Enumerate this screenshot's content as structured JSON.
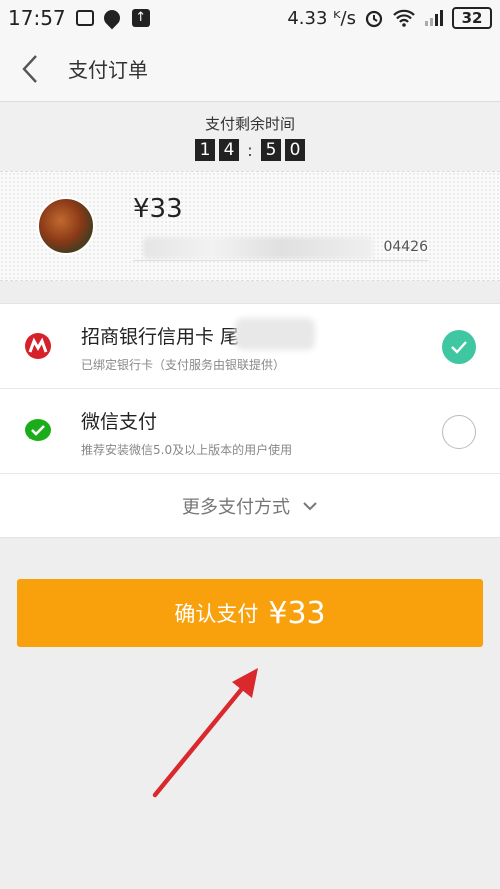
{
  "status_bar": {
    "time": "17:57",
    "speed": "4.33 ᴷ/s",
    "battery": "32",
    "icons": [
      "image-icon",
      "location-pin-icon",
      "upload-icon",
      "alarm-icon",
      "wifi-icon",
      "signal-icon",
      "battery-icon"
    ]
  },
  "nav": {
    "back_icon": "chevron-left-icon",
    "title": "支付订单"
  },
  "timer": {
    "label": "支付剩余时间",
    "d1": "1",
    "d2": "4",
    "sep": ":",
    "d3": "5",
    "d4": "0"
  },
  "order": {
    "price": "¥33",
    "merchant_tail": "04426"
  },
  "payment_methods": [
    {
      "title": "招商银行信用卡 尾",
      "subtitle": "已绑定银行卡（支付服务由银联提供）",
      "icon": "cmb-bank-icon",
      "selected": true
    },
    {
      "title": "微信支付",
      "subtitle": "推荐安装微信5.0及以上版本的用户使用",
      "icon": "wechat-pay-icon",
      "selected": false
    }
  ],
  "more_payments": {
    "label": "更多支付方式",
    "icon": "chevron-down-icon"
  },
  "confirm": {
    "label": "确认支付",
    "price": "¥33"
  },
  "colors": {
    "accent": "#f8a10d",
    "selected": "#3ec7a0",
    "bank_red": "#d6202a",
    "wechat_green": "#1aad19",
    "annotation_arrow": "#d9292c"
  }
}
